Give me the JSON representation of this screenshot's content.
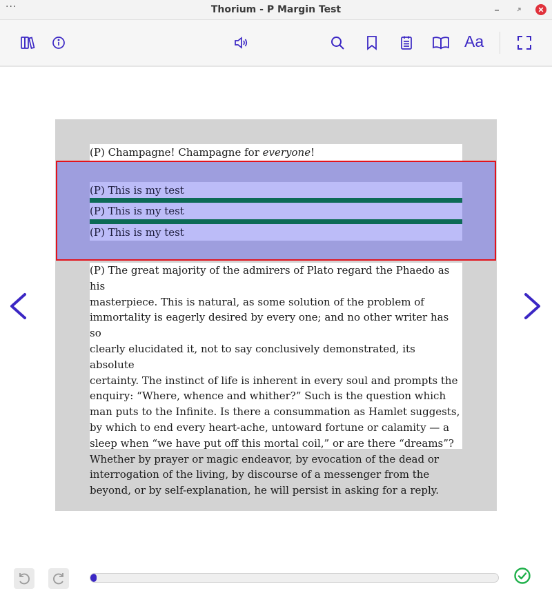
{
  "window": {
    "title": "Thorium - P Margin Test",
    "menu_glyph": "···"
  },
  "toolbar": {
    "icons": [
      "library-icon",
      "info-icon",
      "audio-icon",
      "search-icon",
      "bookmark-icon",
      "notes-icon",
      "toc-icon",
      "text-settings-icon",
      "fullscreen-icon"
    ],
    "text_settings_label": "Aa"
  },
  "reader": {
    "paragraph_first": "(P) Champagne! Champagne for ",
    "paragraph_first_em": "everyone",
    "paragraph_first_end": "!",
    "test_lines": [
      "(P) This is my test",
      "(P) This is my test",
      "(P) This is my test"
    ],
    "long_lines": [
      "(P) The great majority of the admirers of Plato regard the Phaedo as his",
      "masterpiece. This is natural, as some solution of the problem of",
      "immortality is eagerly desired by every one; and no other writer has so",
      "clearly elucidated it, not to say conclusively demonstrated, its absolute",
      "certainty. The instinct of life is inherent in every soul and prompts the",
      "enquiry: “Where, whence and whither?” Such is the question which",
      "man puts to the Infinite. Is there a consummation as Hamlet suggests,",
      "by which to end every heart-ache, untoward fortune or calamity — a",
      "sleep when “we have put off this mortal coil,” or are there “dreams”?",
      "Whether by prayer or magic endeavor, by evocation of the dead or",
      "interrogation of the living, by discourse of a messenger from the",
      "beyond, or by self-explanation, he will persist in asking for a reply."
    ]
  },
  "colors": {
    "accent": "#3b27c4",
    "selection": "#9e9ede",
    "selection_border": "#e2131b",
    "highlight": "#bcbcf8",
    "separator": "#0c6a56",
    "done": "#1fb04a"
  },
  "progress": {
    "fraction": 0.015
  }
}
